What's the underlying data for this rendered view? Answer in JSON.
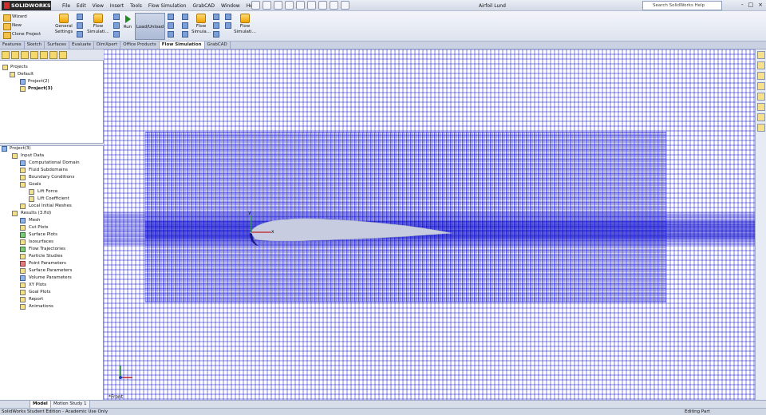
{
  "app": {
    "logo": "SOLIDWORKS",
    "document_title": "Airfoil Lund"
  },
  "menu": [
    "File",
    "Edit",
    "View",
    "Insert",
    "Tools",
    "Flow Simulation",
    "GrabCAD",
    "Window",
    "Help"
  ],
  "search": {
    "placeholder": "Search SolidWorks Help"
  },
  "window_buttons": [
    "-",
    "□",
    "×"
  ],
  "ribbon": {
    "wizard": "Wizard",
    "new": "New",
    "clone_project": "Clone Project",
    "general_settings": "General Settings",
    "flow_simulation_1": "Flow Simulati...",
    "run": "Run",
    "load_unload": "Load/Unload",
    "flow_simulation_2": "Flow Simula...",
    "flow_simulation_3": "Flow Simulati..."
  },
  "tabs": [
    {
      "label": "Features"
    },
    {
      "label": "Sketch"
    },
    {
      "label": "Surfaces"
    },
    {
      "label": "Evaluate"
    },
    {
      "label": "DimXpert"
    },
    {
      "label": "Office Products"
    },
    {
      "label": "Flow Simulation",
      "active": true
    },
    {
      "label": "GrabCAD"
    }
  ],
  "projects_tree": {
    "root": "Projects",
    "default": "Default",
    "project2": "Project(2)",
    "project3": "Project(3)"
  },
  "analysis_tree": {
    "root": "Project(3)",
    "input_data": "Input Data",
    "computational_domain": "Computational Domain",
    "fluid_subdomains": "Fluid Subdomains",
    "boundary_conditions": "Boundary Conditions",
    "goals": "Goals",
    "lift_force": "Lift Force",
    "lift_coefficient": "Lift Coefficient",
    "local_initial_meshes": "Local Initial Meshes",
    "results": "Results (3.fld)",
    "mesh": "Mesh",
    "cut_plots": "Cut Plots",
    "surface_plots": "Surface Plots",
    "isosurfaces": "Isosurfaces",
    "flow_trajectories": "Flow Trajectories",
    "particle_studies": "Particle Studies",
    "point_parameters": "Point Parameters",
    "surface_parameters": "Surface Parameters",
    "volume_parameters": "Volume Parameters",
    "xy_plots": "XY Plots",
    "goal_plots": "Goal Plots",
    "report": "Report",
    "animations": "Animations"
  },
  "viewport": {
    "view_label": "*Front",
    "axis_x": "x",
    "axis_y": "y",
    "mesh_color": "#0000cc"
  },
  "bottom_tabs": [
    "Model",
    "Motion Study 1"
  ],
  "status": {
    "left": "SolidWorks Student Edition - Academic Use Only",
    "right": "Editing Part"
  }
}
